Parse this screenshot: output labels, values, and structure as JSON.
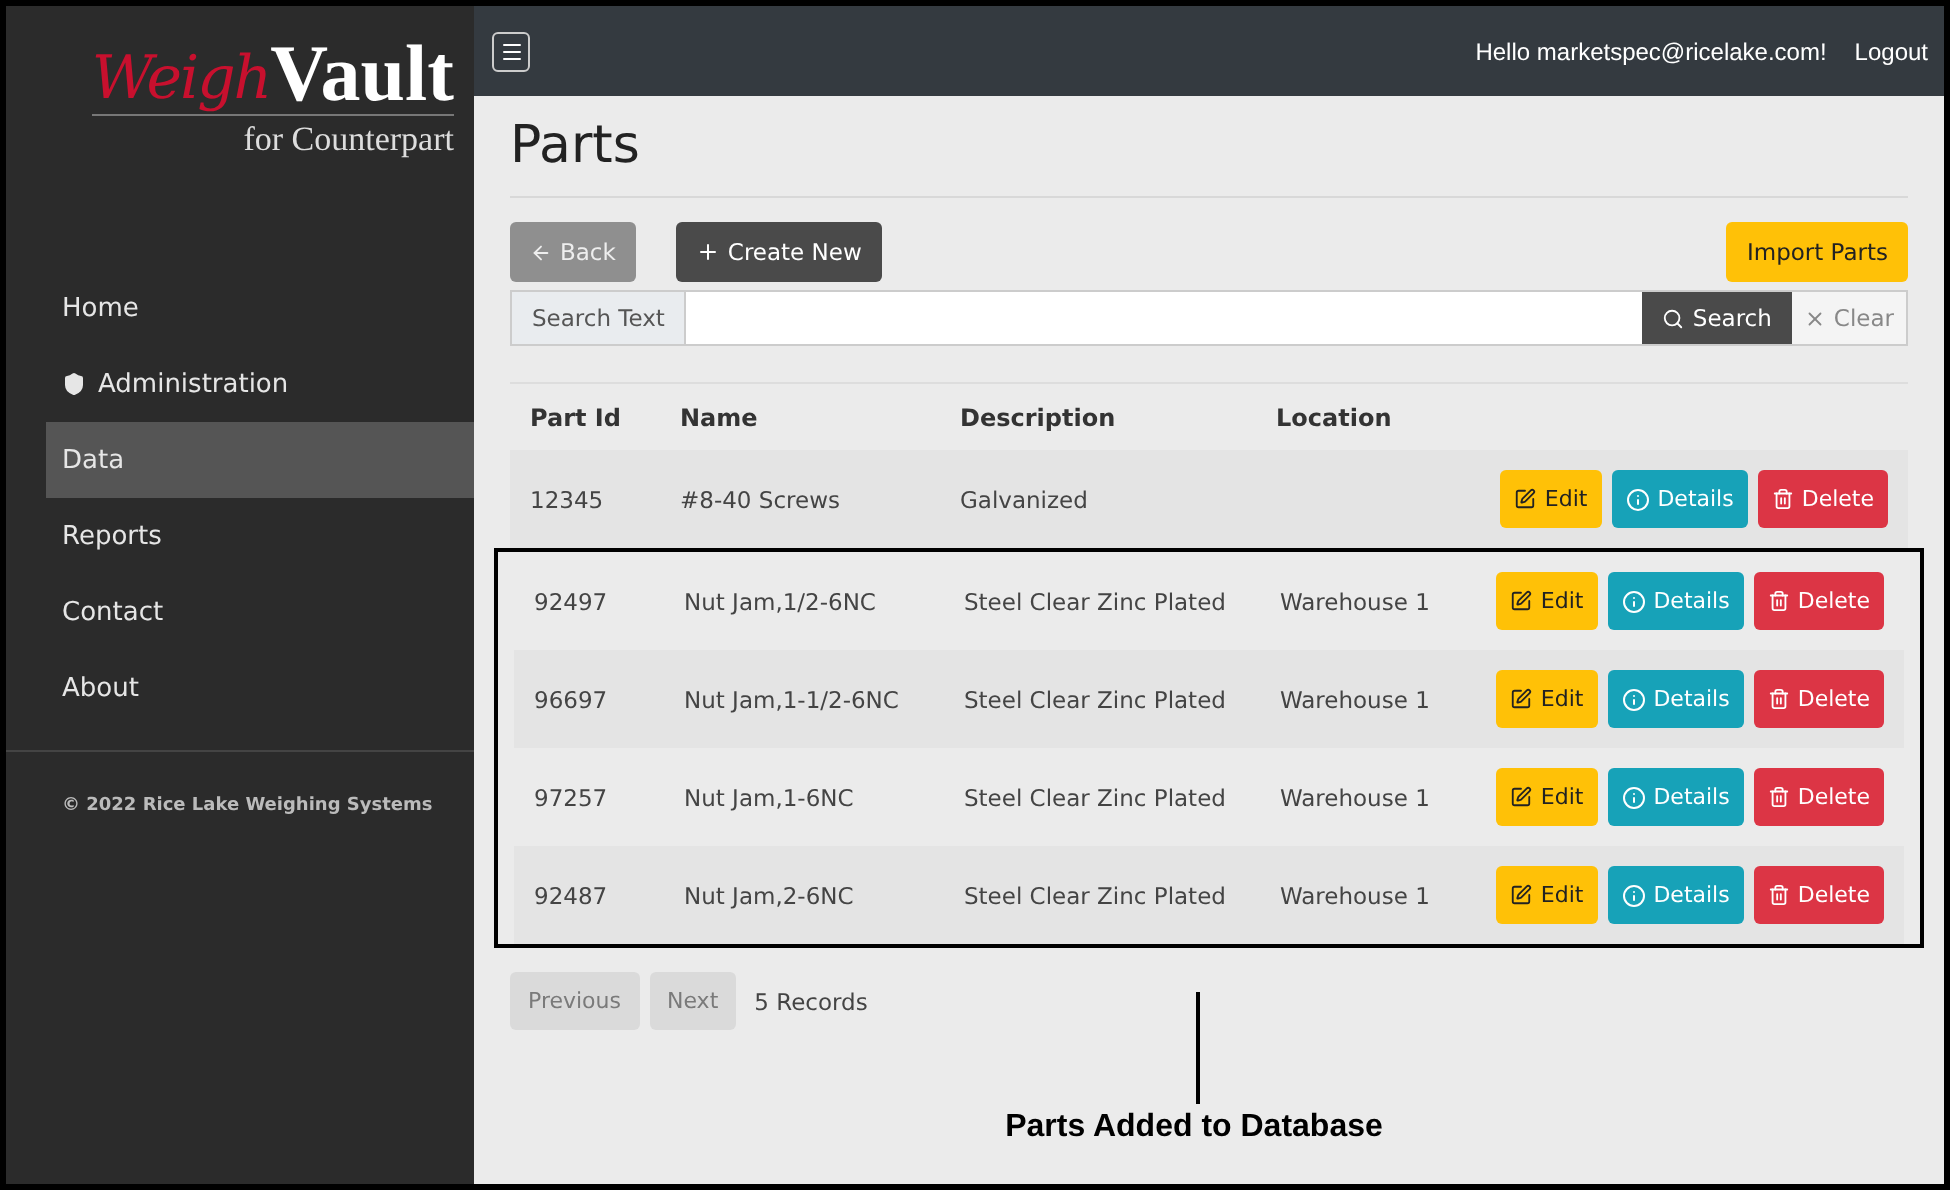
{
  "logo": {
    "script": "Weigh",
    "word": "Vault",
    "subtitle": "for Counterpart"
  },
  "sidebar": {
    "items": [
      {
        "label": "Home",
        "selected": false
      },
      {
        "label": "Administration",
        "selected": false
      },
      {
        "label": "Data",
        "selected": true
      },
      {
        "label": "Reports",
        "selected": false
      },
      {
        "label": "Contact",
        "selected": false
      },
      {
        "label": "About",
        "selected": false
      }
    ],
    "footer": "© 2022 Rice Lake Weighing Systems"
  },
  "topbar": {
    "greeting": "Hello marketspec@ricelake.com!",
    "logout": "Logout"
  },
  "page": {
    "title": "Parts",
    "back": "Back",
    "create": "Create New",
    "import": "Import Parts"
  },
  "search": {
    "addon": "Search Text",
    "search": "Search",
    "clear": "Clear"
  },
  "table": {
    "columns": [
      "Part Id",
      "Name",
      "Description",
      "Location"
    ],
    "rows": [
      {
        "cells": [
          "12345",
          "#8-40 Screws",
          "Galvanized",
          ""
        ],
        "highlighted": false,
        "actions": [
          "Edit",
          "Details",
          "Delete"
        ]
      },
      {
        "cells": [
          "92497",
          "Nut Jam,1/2-6NC",
          "Steel Clear Zinc Plated",
          "Warehouse 1"
        ],
        "highlighted": true,
        "actions": [
          "Edit",
          "Details",
          "Delete"
        ]
      },
      {
        "cells": [
          "96697",
          "Nut Jam,1-1/2-6NC",
          "Steel Clear Zinc Plated",
          "Warehouse 1"
        ],
        "highlighted": true,
        "actions": [
          "Edit",
          "Details",
          "Delete"
        ]
      },
      {
        "cells": [
          "97257",
          "Nut Jam,1-6NC",
          "Steel Clear Zinc Plated",
          "Warehouse 1"
        ],
        "highlighted": true,
        "actions": [
          "Edit",
          "Details",
          "Delete"
        ]
      },
      {
        "cells": [
          "92487",
          "Nut Jam,2-6NC",
          "Steel Clear Zinc Plated",
          "Warehouse 1"
        ],
        "highlighted": true,
        "actions": [
          "Edit",
          "Details",
          "Delete"
        ]
      }
    ]
  },
  "pager": {
    "previous": "Previous",
    "next": "Next",
    "disabled": true,
    "count": "5 Records"
  },
  "annotation": {
    "label": "Parts Added to Database"
  }
}
